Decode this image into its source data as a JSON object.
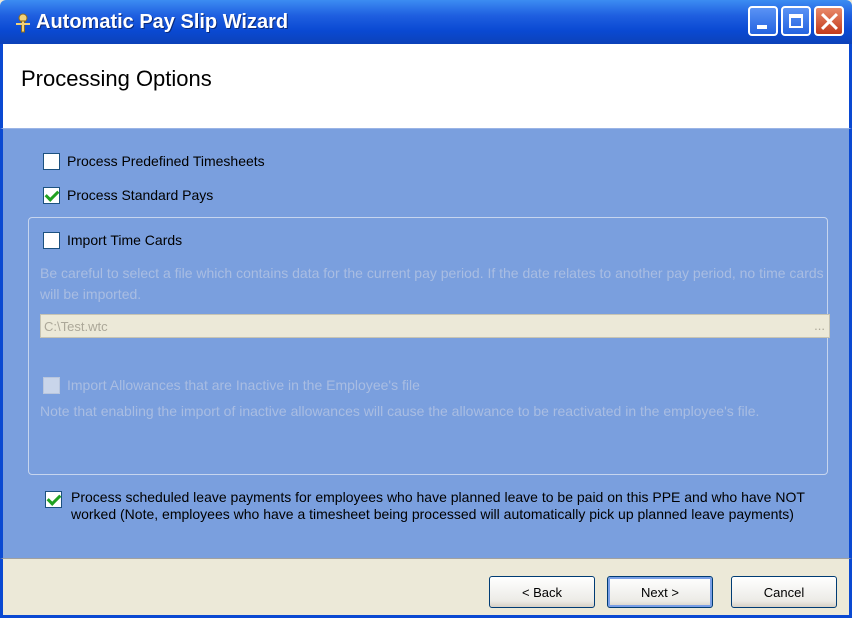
{
  "window": {
    "title": "Automatic Pay Slip Wizard"
  },
  "header": {
    "title": "Processing Options"
  },
  "options": {
    "predefined_timesheets": {
      "label": "Process Predefined Timesheets",
      "checked": false
    },
    "standard_pays": {
      "label": "Process Standard Pays",
      "checked": true
    },
    "import_time_cards": {
      "label": "Import Time Cards",
      "checked": false
    },
    "time_cards_note": "Be careful to select a file which contains data for the current pay period. If the date relates to another pay period, no time cards will be imported.",
    "file_path": "C:\\Test.wtc",
    "browse_label": "...",
    "import_inactive_allowances": {
      "label": "Import Allowances that are Inactive in the Employee's file",
      "checked": false
    },
    "inactive_note": "Note that enabling the import of inactive allowances will cause the allowance to be reactivated in the employee's file.",
    "scheduled_leave": {
      "label": "Process scheduled leave payments for employees who have planned leave to be paid on this PPE and who have NOT worked (Note, employees who have a timesheet being processed will automatically pick up planned leave payments)",
      "checked": true
    }
  },
  "footer": {
    "back_label": "< Back",
    "next_label": "Next >",
    "cancel_label": "Cancel"
  },
  "colors": {
    "titlebar": "#0a49d2",
    "body": "#7a9fde",
    "check": "#21a121"
  }
}
